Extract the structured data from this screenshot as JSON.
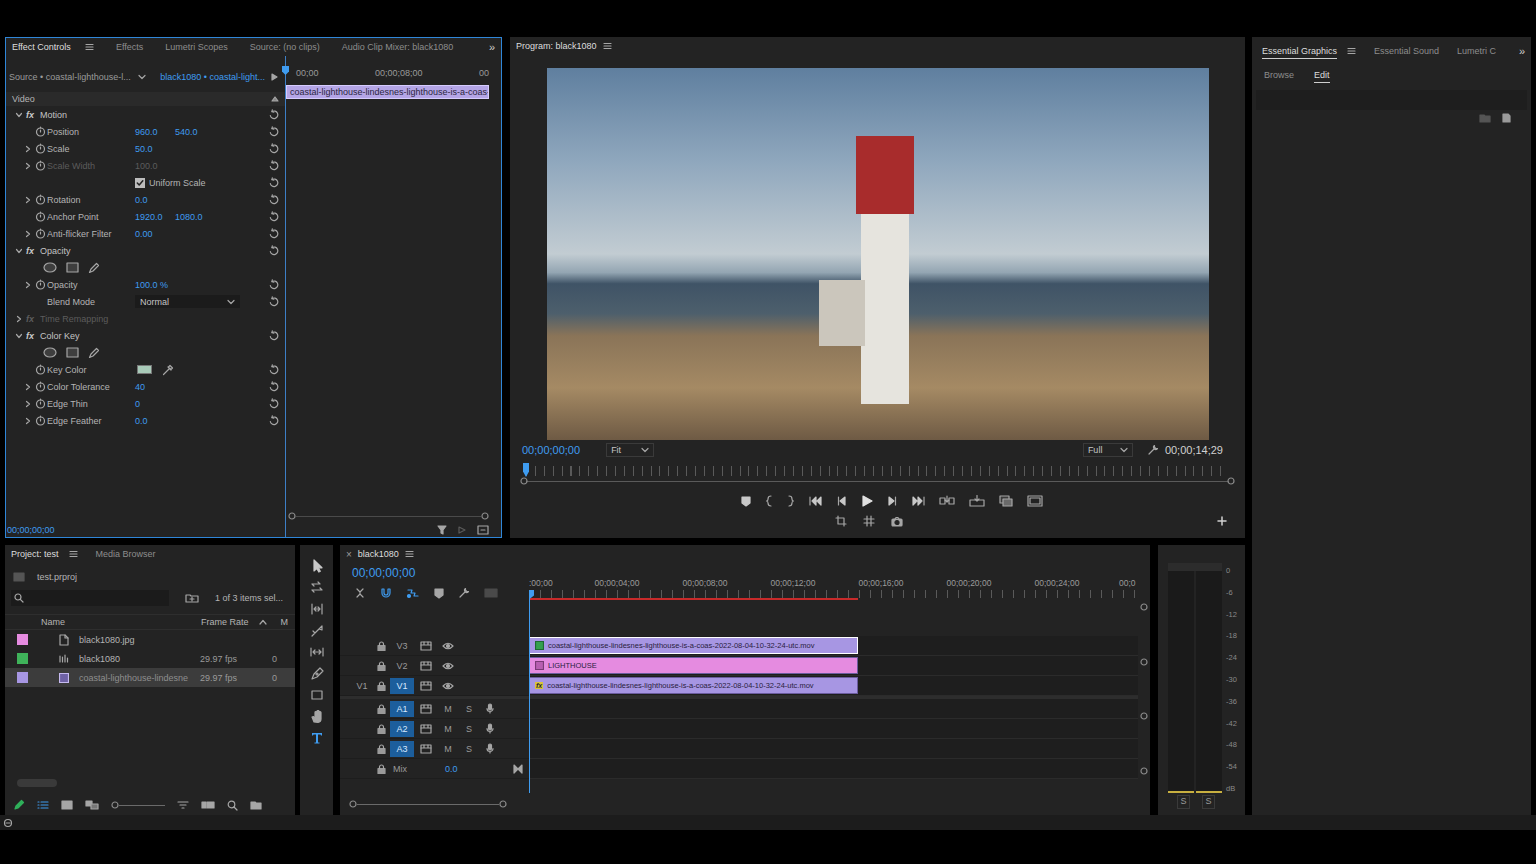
{
  "panel_tabs": [
    {
      "label": "Effect Controls",
      "selected": true
    },
    {
      "label": "Effects",
      "selected": false
    },
    {
      "label": "Lumetri Scopes",
      "selected": false
    },
    {
      "label": "Source: (no clips)",
      "selected": false
    },
    {
      "label": "Audio Clip Mixer: black1080",
      "selected": false
    }
  ],
  "panel_overflow": "»",
  "effect_controls": {
    "source": "Source • coastal-lighthouse-l...",
    "sequence": "black1080 • coastal-light...",
    "ruler": [
      "00;00",
      "00;00;08;00",
      "00"
    ],
    "clip": "coastal-lighthouse-lindesnes-lighthouse-is-a-coas-",
    "section": "Video",
    "rows": [
      {
        "kind": "section",
        "badge": "fx",
        "label": "Motion",
        "expanded": true,
        "disabled": false
      },
      {
        "kind": "param",
        "label": "Position",
        "values": [
          "960.0",
          "540.0"
        ],
        "disabled": false
      },
      {
        "kind": "param",
        "label": "Scale",
        "values": [
          "50.0"
        ],
        "expanded": false,
        "disabled": false
      },
      {
        "kind": "param",
        "label": "Scale Width",
        "values": [
          "100.0"
        ],
        "expanded": false,
        "disabled": true
      },
      {
        "kind": "checkbox",
        "label": "Uniform Scale",
        "checked": true
      },
      {
        "kind": "param",
        "label": "Rotation",
        "values": [
          "0.0"
        ],
        "expanded": false,
        "disabled": false
      },
      {
        "kind": "param",
        "label": "Anchor Point",
        "values": [
          "1920.0",
          "1080.0"
        ],
        "disabled": false
      },
      {
        "kind": "param",
        "label": "Anti-flicker Filter",
        "values": [
          "0.00"
        ],
        "expanded": false,
        "disabled": false
      },
      {
        "kind": "section",
        "badge": "fx",
        "label": "Opacity",
        "expanded": true,
        "disabled": false
      },
      {
        "kind": "masks"
      },
      {
        "kind": "param",
        "label": "Opacity",
        "values": [
          "100.0 %"
        ],
        "expanded": false,
        "disabled": false
      },
      {
        "kind": "dropdown",
        "label": "Blend Mode",
        "value": "Normal"
      },
      {
        "kind": "section",
        "badge": "fx",
        "label": "Time Remapping",
        "expanded": false,
        "disabled": true
      },
      {
        "kind": "section",
        "badge": "fx",
        "label": "Color Key",
        "expanded": true,
        "disabled": false
      },
      {
        "kind": "masks"
      },
      {
        "kind": "color",
        "label": "Key Color",
        "swatch": "#a9cbb9"
      },
      {
        "kind": "param",
        "label": "Color Tolerance",
        "values": [
          "40"
        ],
        "expanded": false,
        "disabled": false
      },
      {
        "kind": "param",
        "label": "Edge Thin",
        "values": [
          "0"
        ],
        "expanded": false,
        "disabled": false
      },
      {
        "kind": "param",
        "label": "Edge Feather",
        "values": [
          "0.0"
        ],
        "expanded": false,
        "disabled": false
      }
    ],
    "timecode": "00;00;00;00"
  },
  "program": {
    "tabs": [
      {
        "label": "Program: black1080",
        "selected": true
      }
    ],
    "timecode": "00;00;00;00",
    "zoom": "Fit",
    "quality": "Full",
    "duration": "00;00;14;29",
    "playhead": 0
  },
  "essential_graphics": {
    "tabs": [
      {
        "label": "Essential Graphics",
        "selected": true
      },
      {
        "label": "Essential Sound",
        "selected": false
      },
      {
        "label": "Lumetri C",
        "selected": false
      }
    ],
    "overflow": "»",
    "subtabs": [
      {
        "label": "Browse",
        "selected": false
      },
      {
        "label": "Edit",
        "selected": true
      }
    ]
  },
  "project": {
    "tabs": [
      {
        "label": "Project: test",
        "selected": true
      },
      {
        "label": "Media Browser",
        "selected": false
      }
    ],
    "file": "test.prproj",
    "count": "1 of 3 items sel...",
    "columns": [
      "Name",
      "Frame Rate",
      "M"
    ],
    "rows": [
      {
        "name": "black1080.jpg",
        "frame_rate": "",
        "m": "",
        "color": "#e58be0",
        "kind": "image",
        "selected": false
      },
      {
        "name": "black1080",
        "frame_rate": "29.97 fps",
        "m": "0",
        "color": "#3fb35a",
        "kind": "sequence",
        "selected": false
      },
      {
        "name": "coastal-lighthouse-lindesne",
        "frame_rate": "29.97 fps",
        "m": "0",
        "color": "#a796e3",
        "kind": "clip",
        "selected": true
      }
    ]
  },
  "tools": [
    {
      "kind": "selection",
      "selected": false
    },
    {
      "kind": "track-select",
      "selected": false
    },
    {
      "kind": "ripple",
      "selected": false
    },
    {
      "kind": "razor",
      "selected": false
    },
    {
      "kind": "slip",
      "selected": false
    },
    {
      "kind": "pen",
      "selected": false
    },
    {
      "kind": "rectangle",
      "selected": false
    },
    {
      "kind": "hand",
      "selected": false
    },
    {
      "kind": "type",
      "selected": true
    }
  ],
  "timeline": {
    "close": "×",
    "tabs": [
      {
        "label": "black1080",
        "selected": true
      }
    ],
    "timecode": "00;00;00;00",
    "playhead_s": 0,
    "work_area_end_s": 14.97,
    "ruler": [
      {
        "label": ":00;00",
        "t": 0
      },
      {
        "label": "00;00;04;00",
        "t": 4
      },
      {
        "label": "00;00;08;00",
        "t": 8
      },
      {
        "label": "00;00;12;00",
        "t": 12
      },
      {
        "label": "00;00;16;00",
        "t": 16
      },
      {
        "label": "00;00;20;00",
        "t": 20
      },
      {
        "label": "00;00;24;00",
        "t": 24
      },
      {
        "label": "00;0",
        "t": 28
      }
    ],
    "video_tracks": [
      {
        "patch": "",
        "target": "V3",
        "targeted": false,
        "clip": {
          "name": "coastal-lighthouse-lindesnes-lighthouse-is-a-coas-2022-08-04-10-32-24-utc.mov",
          "kind": "video",
          "badge": "",
          "start_s": 0,
          "end_s": 14.97,
          "color": "#a796e3",
          "selected": true
        }
      },
      {
        "patch": "",
        "target": "V2",
        "targeted": false,
        "clip": {
          "name": "LIGHTHOUSE",
          "kind": "graphic",
          "badge": "",
          "start_s": 0,
          "end_s": 14.97,
          "color": "#e58be0",
          "selected": false
        }
      },
      {
        "patch": "V1",
        "target": "V1",
        "targeted": true,
        "clip": {
          "name": "coastal-lighthouse-lindesnes-lighthouse-is-a-coas-2022-08-04-10-32-24-utc.mov",
          "kind": "video",
          "badge": "fx",
          "start_s": 0,
          "end_s": 14.97,
          "color": "#a796e3",
          "selected": false
        }
      }
    ],
    "audio_tracks": [
      {
        "patch": "",
        "target": "A1",
        "targeted": true,
        "mute": "M",
        "solo": "S"
      },
      {
        "patch": "",
        "target": "A2",
        "targeted": true,
        "mute": "M",
        "solo": "S"
      },
      {
        "patch": "",
        "target": "A3",
        "targeted": true,
        "mute": "M",
        "solo": "S"
      }
    ],
    "mix": {
      "label": "Mix",
      "value": "0.0"
    }
  },
  "audio_meter": {
    "scale": [
      "0",
      "-6",
      "-12",
      "-18",
      "-24",
      "-30",
      "-36",
      "-42",
      "-48",
      "-54",
      "dB"
    ],
    "solo": [
      "S",
      "S"
    ],
    "levels": [
      0.01,
      0.01
    ]
  }
}
